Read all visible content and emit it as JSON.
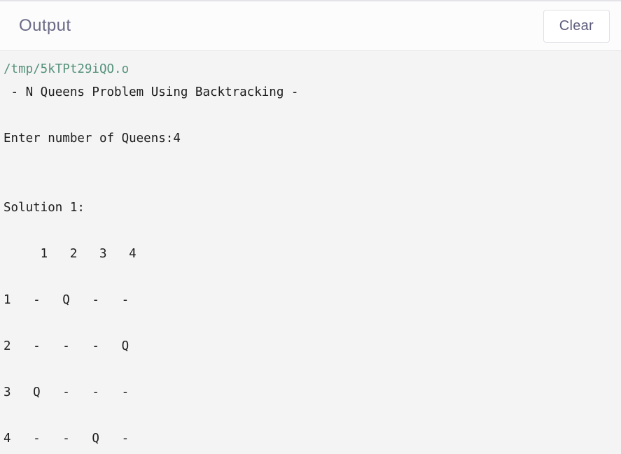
{
  "header": {
    "title": "Output",
    "clear_label": "Clear"
  },
  "colors": {
    "panel_background": "#f4f4f4",
    "header_background": "#fcfcfd",
    "title_text": "#6a6a86",
    "button_text": "#5c5c7b",
    "button_border": "#e1e1e6",
    "output_text": "#1c1c1c",
    "file_path_text": "#55917a",
    "divider": "#e6e6ea"
  },
  "output": {
    "file_path": "/tmp/5kTPt29iQO.o",
    "lines": [
      " - N Queens Problem Using Backtracking -",
      "",
      "Enter number of Queens:4",
      "",
      "",
      "Solution 1:",
      "",
      "     1   2   3   4",
      "",
      "1   -   Q   -   -",
      "",
      "2   -   -   -   Q",
      "",
      "3   Q   -   -   -",
      "",
      "4   -   -   Q   -"
    ],
    "program": {
      "banner": "- N Queens Problem Using Backtracking -",
      "prompt": "Enter number of Queens:",
      "queens_entered": "4",
      "solution_label": "Solution 1:",
      "board": {
        "column_headers": [
          "1",
          "2",
          "3",
          "4"
        ],
        "row_headers": [
          "1",
          "2",
          "3",
          "4"
        ],
        "queen_symbol": "Q",
        "empty_symbol": "-",
        "cells": [
          [
            "-",
            "Q",
            "-",
            "-"
          ],
          [
            "-",
            "-",
            "-",
            "Q"
          ],
          [
            "Q",
            "-",
            "-",
            "-"
          ],
          [
            "-",
            "-",
            "Q",
            "-"
          ]
        ]
      }
    }
  }
}
